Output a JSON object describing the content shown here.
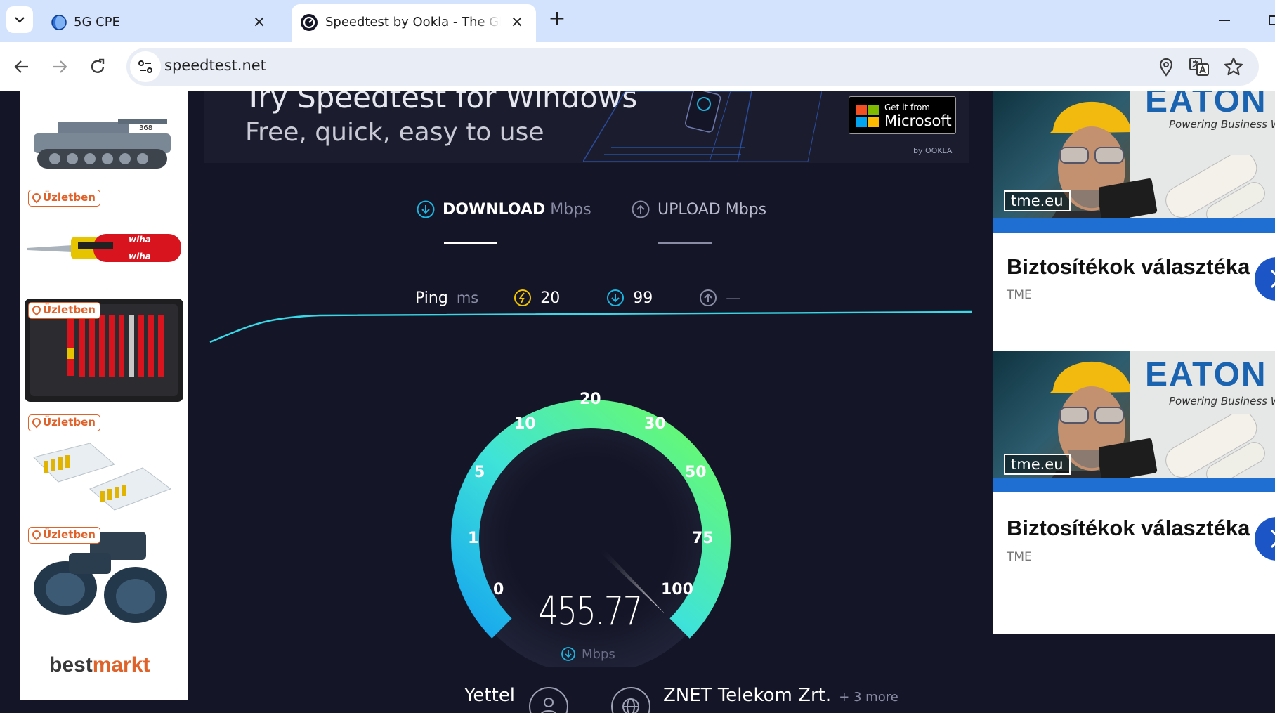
{
  "browser": {
    "tabs": [
      {
        "title": "5G CPE",
        "icon": "globe-icon"
      },
      {
        "title": "Speedtest by Ookla - The Global Broadband Speed Test",
        "icon": "speedtest-icon"
      }
    ],
    "new_tab": "+",
    "address": "speedtest.net",
    "icons": [
      "back-icon",
      "forward-icon",
      "reload-icon",
      "site-info-icon",
      "location-icon",
      "translate-icon",
      "star-icon",
      "minimize-icon"
    ]
  },
  "left_ads": {
    "badge": "Üzletben",
    "brand_a": "best",
    "brand_b": "markt",
    "items": [
      "rc-tank",
      "wiha-screwdriver",
      "wiha-tool-set",
      "rj45-connectors",
      "binoculars"
    ]
  },
  "banner": {
    "title": "Try Speedtest for Windows",
    "subtitle": "Free, quick, easy to use",
    "store_small": "Get it from",
    "store_big": "Microsoft",
    "by": "by OOKLA"
  },
  "tabs": {
    "download": "DOWNLOAD",
    "upload": "UPLOAD",
    "unit": "Mbps"
  },
  "ping": {
    "label": "Ping",
    "unit": "ms",
    "idle": "20",
    "download": "99",
    "upload": "—"
  },
  "gauge": {
    "ticks": [
      "0",
      "1",
      "5",
      "10",
      "20",
      "30",
      "50",
      "75",
      "100"
    ],
    "value": "455.77",
    "unit": "Mbps",
    "needle_value": 100
  },
  "connection": {
    "isp": "Yettel",
    "server": "ZNET Telekom Zrt.",
    "more": "+ 3 more"
  },
  "right_ads": {
    "brand": "EATON",
    "tagline": "Powering Business Worldwide",
    "domain": "tme.eu",
    "title": "Biztosítékok választéka",
    "advertiser": "TME"
  },
  "colors": {
    "page_bg": "#141526",
    "accent_cyan": "#1cb5e0",
    "gauge_green": "#6dfd60",
    "ms_blue": "#0078d4"
  }
}
